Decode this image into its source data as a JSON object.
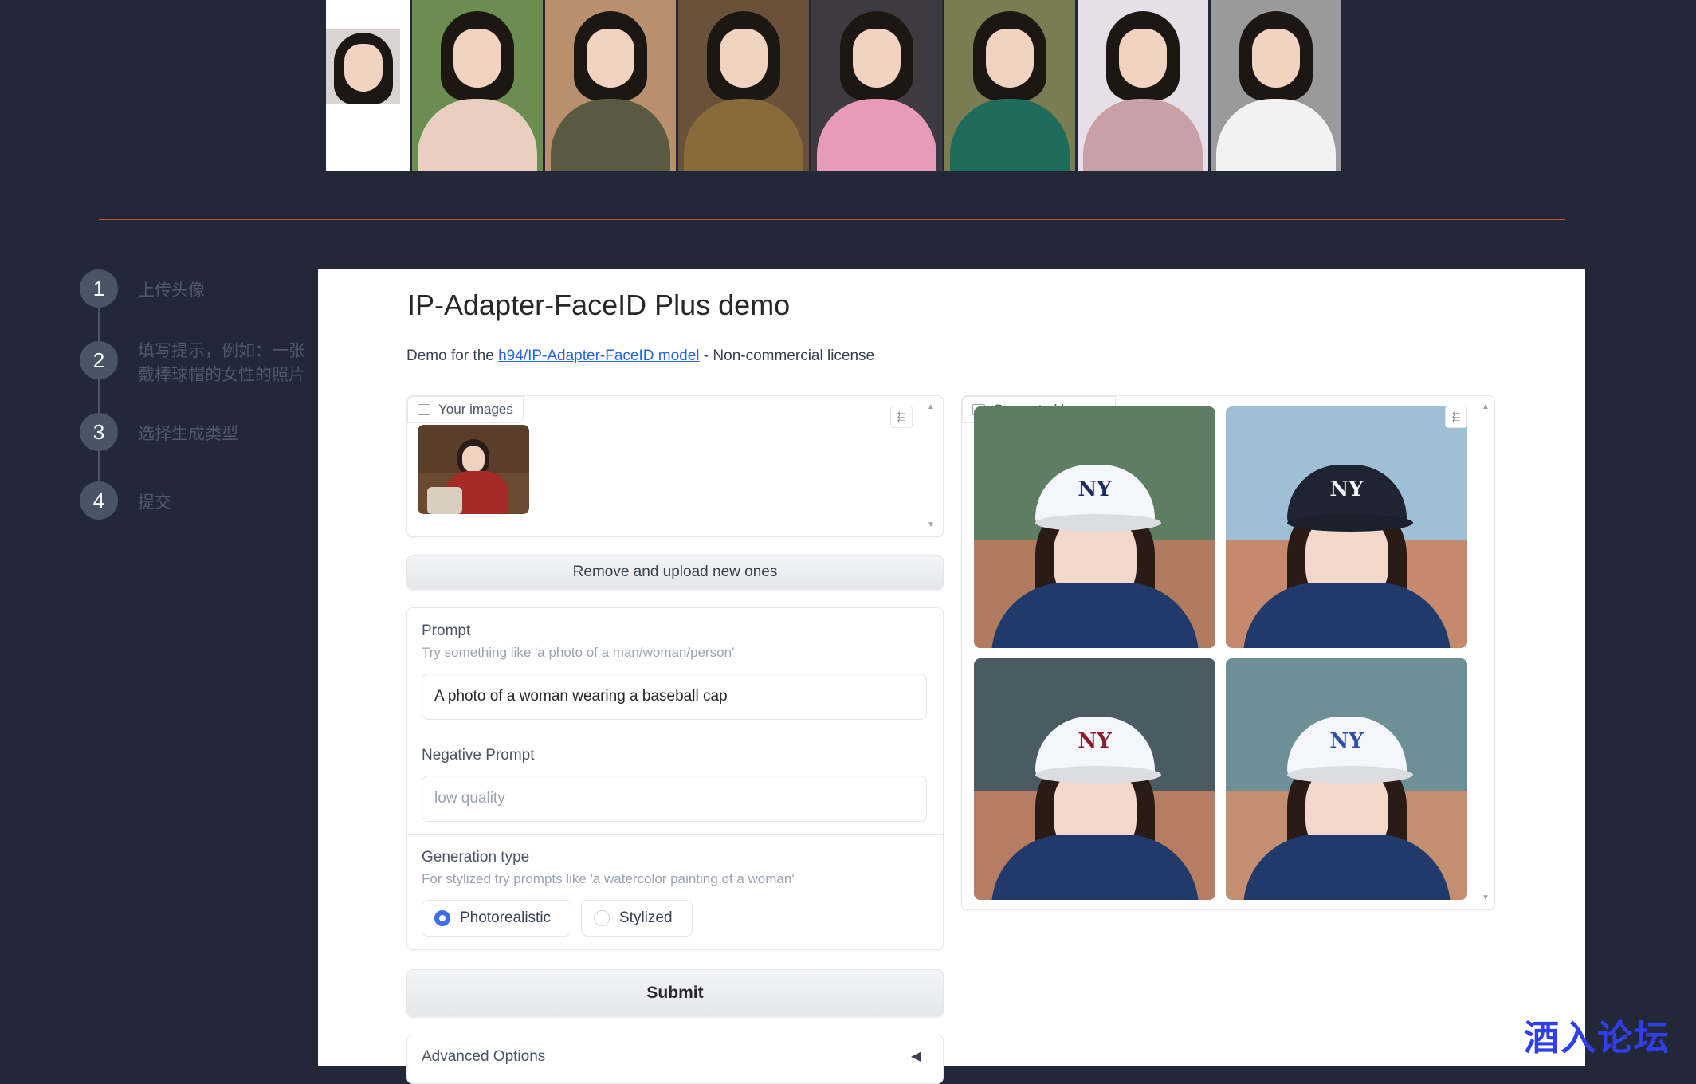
{
  "banner": {
    "tiles": [
      {
        "bg": "#ffffff",
        "body": "#ffffff"
      },
      {
        "bg": "#6b8d4f",
        "body": "#e8cfc0"
      },
      {
        "bg": "#b98f6e",
        "body": "#5a5a43"
      },
      {
        "bg": "#6a513a",
        "body": "#8a6a3a"
      },
      {
        "bg": "#3e3a42",
        "body": "#e79bb8"
      },
      {
        "bg": "#7a7c52",
        "body": "#1f6b5c"
      },
      {
        "bg": "#e7dfe7",
        "body": "#c8a0a6"
      },
      {
        "bg": "#9a9a9a",
        "body": "#f2f2f2"
      }
    ]
  },
  "steps": [
    {
      "number": "1",
      "label": "上传头像"
    },
    {
      "number": "2",
      "label": "填写提示，例如：一张戴棒球帽的女性的照片"
    },
    {
      "number": "3",
      "label": "选择生成类型"
    },
    {
      "number": "4",
      "label": "提交"
    }
  ],
  "app": {
    "title": "IP-Adapter-FaceID Plus demo",
    "desc_prefix": "Demo for the ",
    "desc_link": "h94/IP-Adapter-FaceID model",
    "desc_suffix": " - Non-commercial license"
  },
  "your_images": {
    "label": "Your images"
  },
  "remove_button": "Remove and upload new ones",
  "prompt": {
    "label": "Prompt",
    "info": "Try something like 'a photo of a man/woman/person'",
    "value": "A photo of a woman wearing a baseball cap"
  },
  "negative_prompt": {
    "label": "Negative Prompt",
    "placeholder": "low quality"
  },
  "generation_type": {
    "label": "Generation type",
    "info": "For stylized try prompts like 'a watercolor painting of a woman'",
    "options": [
      "Photorealistic",
      "Stylized"
    ],
    "selected": "Photorealistic"
  },
  "submit_button": "Submit",
  "advanced_options": {
    "label": "Advanced Options"
  },
  "generated_images": {
    "label": "Generated Images",
    "items": [
      {
        "cap": "#f4f6fb",
        "logo": "NY",
        "logo_color": "#1d2d5a",
        "sky": "#5f7d63",
        "field": "#b27a5e"
      },
      {
        "cap": "#1e2431",
        "logo": "NY",
        "logo_color": "#f4f6fb",
        "sky": "#9fbfd6",
        "field": "#c58a6c"
      },
      {
        "cap": "#f4f6fb",
        "logo": "NY",
        "logo_color": "#8a1c2c",
        "sky": "#4a5b64",
        "field": "#b67d63"
      },
      {
        "cap": "#f4f6fb",
        "logo": "NY",
        "logo_color": "#2f4fa8",
        "sky": "#6d8f96",
        "field": "#c38f70"
      }
    ]
  },
  "watermark": "酒入论坛",
  "colors": {
    "accent": "#3b6ee8",
    "link": "#2563eb",
    "page_bg": "#232838"
  }
}
